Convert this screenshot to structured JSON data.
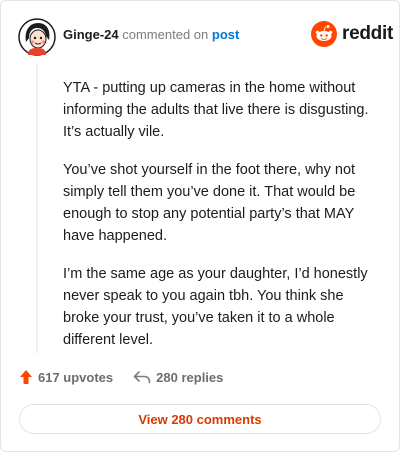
{
  "comment": {
    "username": "Ginge-24",
    "commented_on": "commented on",
    "post_link": "post",
    "paragraphs": [
      "YTA - putting up cameras in the home without informing the adults that live there is disgusting. It’s actually vile.",
      "You’ve shot yourself in the foot there, why not simply tell them you’ve done it. That would be enough to stop any potential party’s that MAY have happened.",
      "I’m the same age as your daughter, I’d honestly never speak to you again tbh. You think she broke your trust, you’ve taken it to a whole different level."
    ]
  },
  "brand": {
    "logo_text": "reddit",
    "icon": "reddit-snoo-icon",
    "accent_color": "#ff4500"
  },
  "stats": {
    "upvotes_label": "617 upvotes",
    "replies_label": "280 replies",
    "upvote_icon": "upvote-arrow-icon",
    "reply_icon": "reply-arrow-icon"
  },
  "footer": {
    "view_comments_label": "View 280 comments"
  },
  "colors": {
    "link_blue": "#0079d3",
    "orange_text": "#d93a00"
  }
}
